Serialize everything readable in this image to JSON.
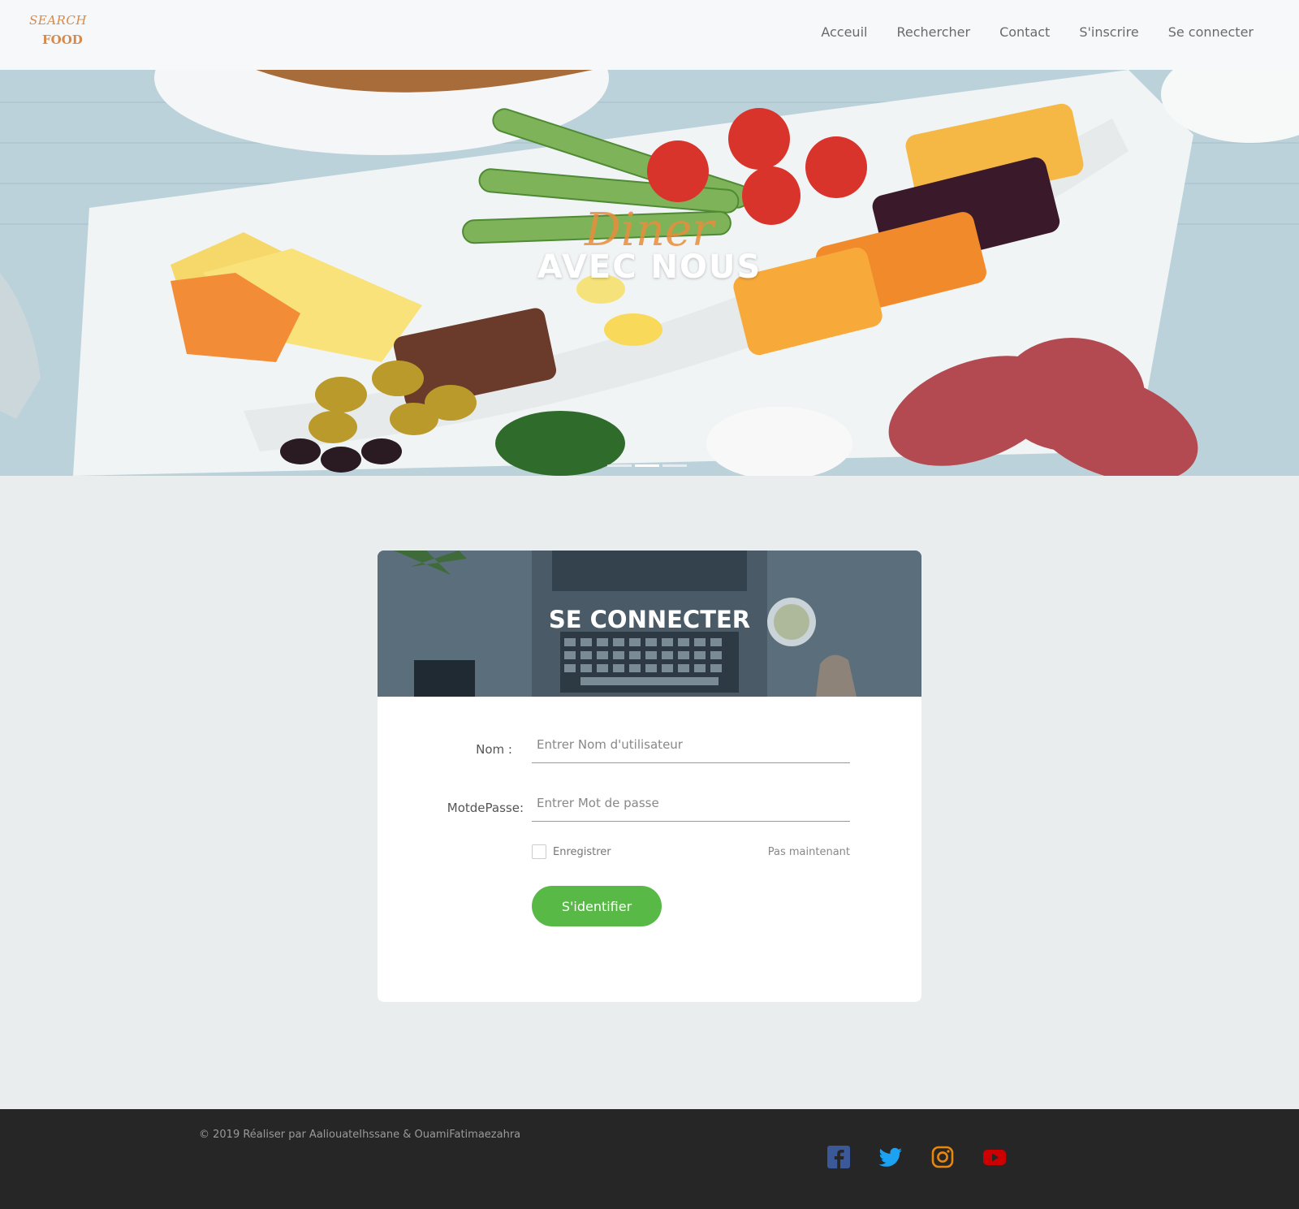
{
  "header": {
    "logo_line1": "SEARCH",
    "logo_line2": "FOOD",
    "nav": [
      {
        "label": "Acceuil"
      },
      {
        "label": "Rechercher"
      },
      {
        "label": "Contact"
      },
      {
        "label": "S'inscrire"
      },
      {
        "label": "Se connecter"
      }
    ]
  },
  "hero": {
    "script_text": "Diner",
    "title": "AVEC NOUS",
    "slides_count": 3,
    "active_slide": 2
  },
  "login": {
    "title": "SE CONNECTER",
    "name_label": "Nom :",
    "name_placeholder": "Entrer Nom d'utilisateur",
    "password_label": "MotdePasse:",
    "password_placeholder": "Entrer Mot de passe",
    "remember_label": "Enregistrer",
    "later_link": "Pas maintenant",
    "submit_label": "S'identifier"
  },
  "footer": {
    "copyright": "© 2019 Réaliser par AaliouateIhssane & OuamiFatimaezahra",
    "social": [
      {
        "icon": "facebook-icon",
        "color": "#3b5998"
      },
      {
        "icon": "twitter-icon",
        "color": "#1da1f2"
      },
      {
        "icon": "instagram-icon",
        "color": "#e8870e"
      },
      {
        "icon": "youtube-icon",
        "color": "#cc0000"
      }
    ]
  },
  "colors": {
    "accent_green": "#58b947",
    "logo_orange": "#d58a4a",
    "footer_bg": "#262626",
    "page_bg": "#e9eded"
  }
}
